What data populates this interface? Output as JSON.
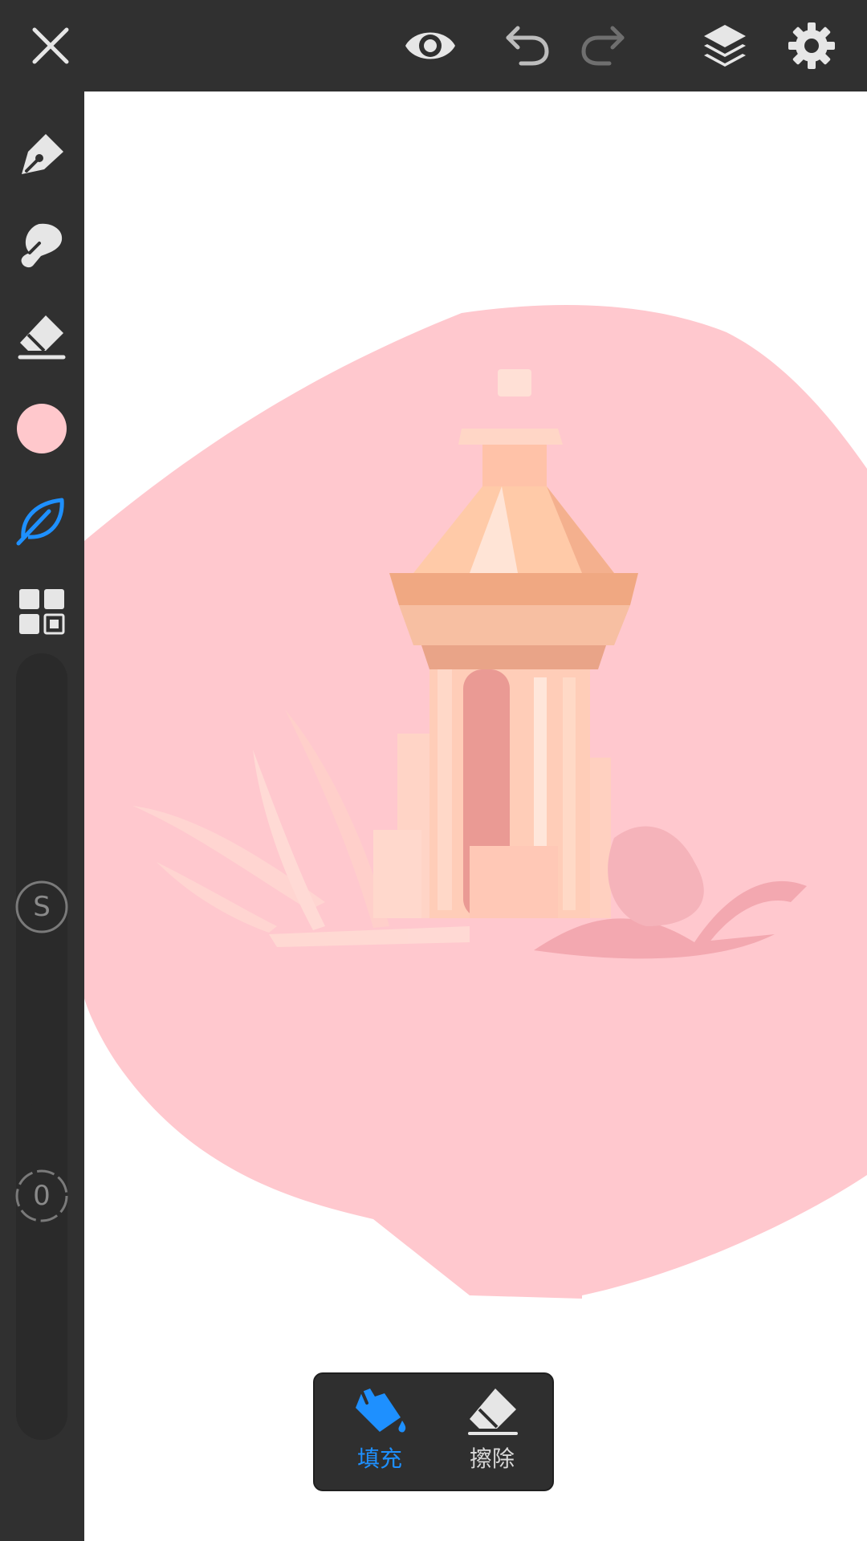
{
  "colors": {
    "accent": "#1e90ff",
    "toolbar_bg": "#303030",
    "icon": "#e6e6e6",
    "icon_dim": "#7a7a7a",
    "current_color": "#ffc8cc",
    "canvas_bg": "#ffffff",
    "blob": "#ffc8ce"
  },
  "topbar": {
    "close": "close-icon",
    "preview": "eye-icon",
    "undo": "undo-icon",
    "redo": "redo-icon",
    "layers": "layers-icon",
    "settings": "gear-icon"
  },
  "sidebar": {
    "tools": [
      "pen-icon",
      "smudge-icon",
      "eraser-icon",
      "color-swatch",
      "leaf-brush-icon",
      "grid-icon"
    ],
    "size_slider": {
      "label": "S"
    },
    "opacity_slider": {
      "label": "0"
    }
  },
  "fill_panel": {
    "fill_label": "填充",
    "erase_label": "擦除"
  }
}
